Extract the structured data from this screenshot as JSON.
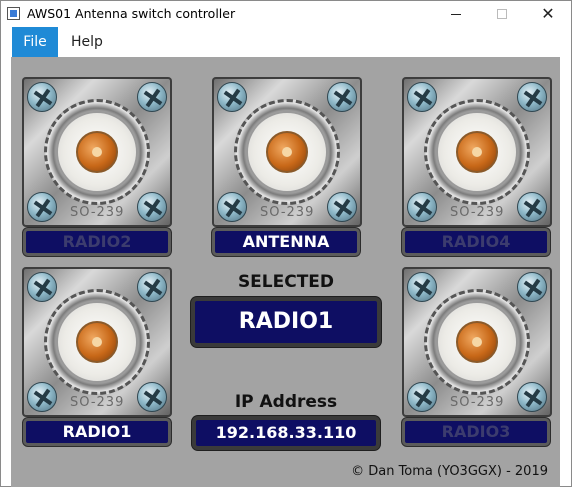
{
  "window": {
    "title": "AWS01 Antenna switch controller",
    "close_glyph": "✕"
  },
  "menu": {
    "items": [
      {
        "label": "File"
      },
      {
        "label": "Help"
      }
    ]
  },
  "connectors": [
    {
      "stamp": "SO-239",
      "label": "RADIO2",
      "state": "inactive"
    },
    {
      "stamp": "SO-239",
      "label": "ANTENNA",
      "state": "active"
    },
    {
      "stamp": "SO-239",
      "label": "RADIO4",
      "state": "inactive"
    },
    {
      "stamp": "SO-239",
      "label": "RADIO1",
      "state": "active"
    },
    {
      "stamp": "SO-239",
      "label": "RADIO3",
      "state": "inactive"
    }
  ],
  "selected": {
    "heading": "SELECTED",
    "value": "RADIO1"
  },
  "ip": {
    "heading": "IP Address",
    "value": "192.168.33.110"
  },
  "footer": {
    "copyright": "© Dan Toma (YO3GGX) - 2019"
  },
  "colors": {
    "accent": "#1f8ad6",
    "panel_background": "#a3a3a3",
    "label_background": "#0e0e63",
    "label_active_text": "#ffffff",
    "label_inactive_text": "#3c3c6e"
  }
}
